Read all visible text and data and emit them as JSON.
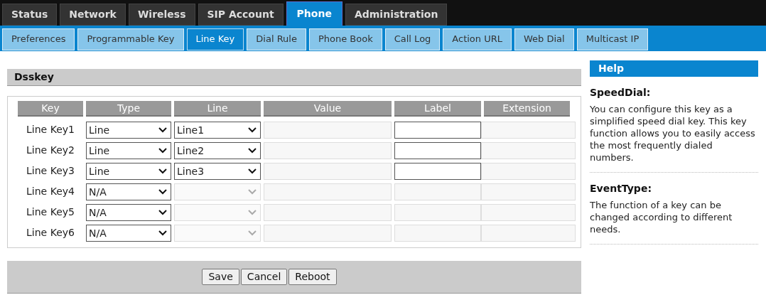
{
  "main_tabs": [
    {
      "label": "Status",
      "selected": false
    },
    {
      "label": "Network",
      "selected": false
    },
    {
      "label": "Wireless",
      "selected": false
    },
    {
      "label": "SIP Account",
      "selected": false
    },
    {
      "label": "Phone",
      "selected": true
    },
    {
      "label": "Administration",
      "selected": false
    }
  ],
  "sub_tabs": [
    {
      "label": "Preferences",
      "selected": false
    },
    {
      "label": "Programmable Key",
      "selected": false
    },
    {
      "label": "Line Key",
      "selected": true
    },
    {
      "label": "Dial Rule",
      "selected": false
    },
    {
      "label": "Phone Book",
      "selected": false
    },
    {
      "label": "Call Log",
      "selected": false
    },
    {
      "label": "Action URL",
      "selected": false
    },
    {
      "label": "Web Dial",
      "selected": false
    },
    {
      "label": "Multicast IP",
      "selected": false
    }
  ],
  "section": {
    "title": "Dsskey"
  },
  "table": {
    "columns": [
      "Key",
      "Type",
      "Line",
      "Value",
      "Label",
      "Extension"
    ],
    "rows": [
      {
        "key": "Line Key1",
        "type": "Line",
        "line": "Line1",
        "disabled": false
      },
      {
        "key": "Line Key2",
        "type": "Line",
        "line": "Line2",
        "disabled": false
      },
      {
        "key": "Line Key3",
        "type": "Line",
        "line": "Line3",
        "disabled": false
      },
      {
        "key": "Line Key4",
        "type": "N/A",
        "disabled": true
      },
      {
        "key": "Line Key5",
        "type": "N/A",
        "disabled": true
      },
      {
        "key": "Line Key6",
        "type": "N/A",
        "disabled": true
      }
    ]
  },
  "buttons": [
    "Save",
    "Cancel",
    "Reboot"
  ],
  "help": {
    "title": "Help",
    "entries": [
      {
        "heading": "SpeedDial:",
        "text": "You can configure this key as a simplified speed dial key. This key function allows you to easily access the most frequently dialed numbers."
      },
      {
        "heading": "EventType:",
        "text": "The function of a key can be changed according to different needs."
      }
    ]
  }
}
